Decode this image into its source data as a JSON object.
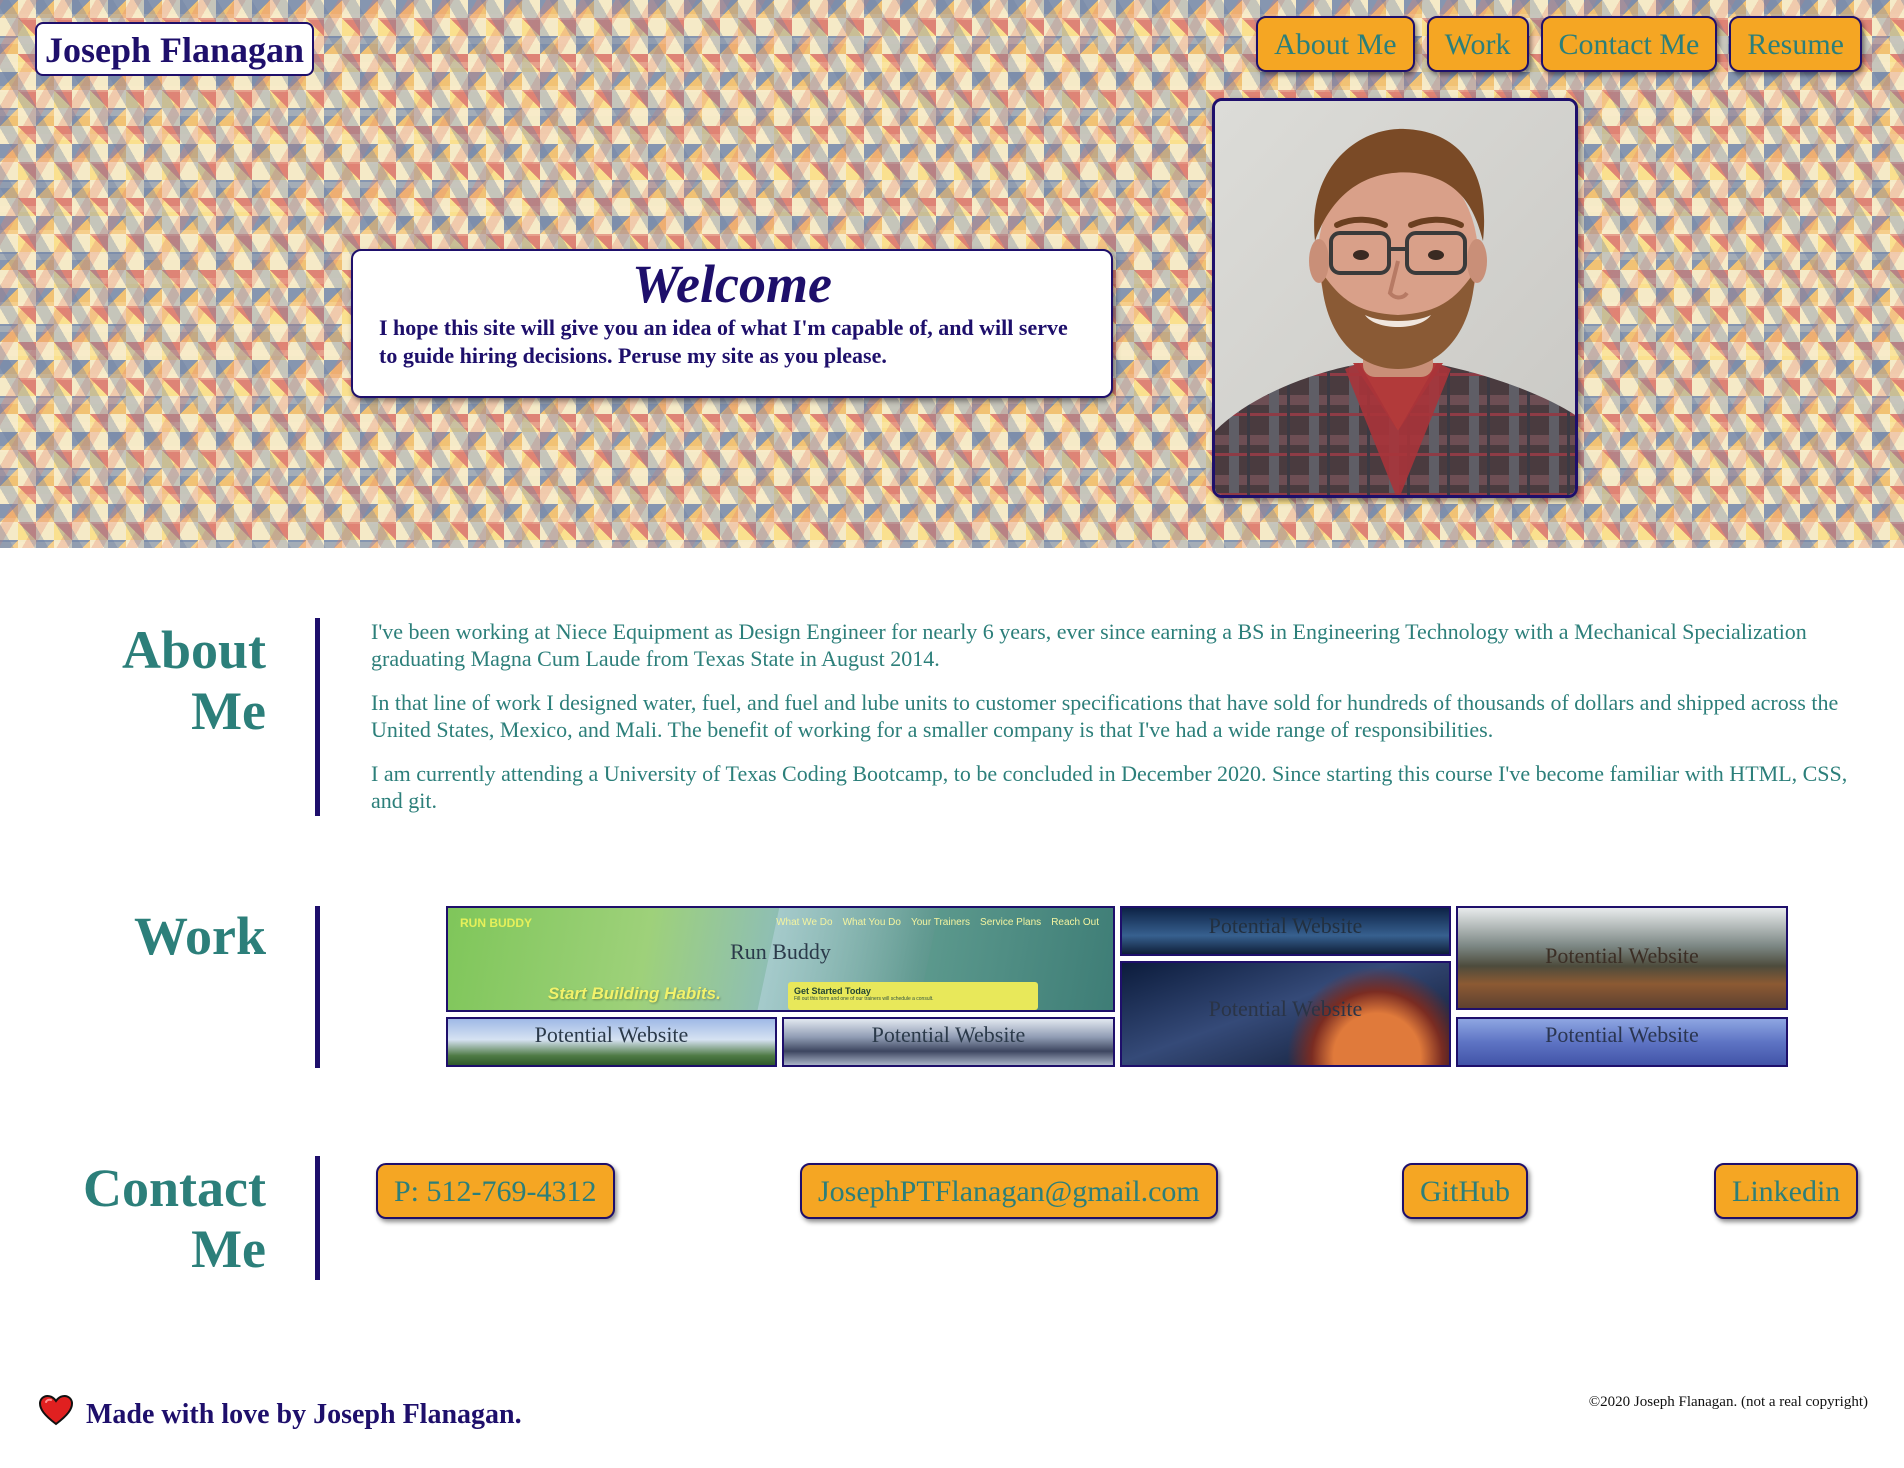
{
  "header": {
    "brand": "Joseph Flanagan",
    "nav": [
      "About Me",
      "Work",
      "Contact Me",
      "Resume"
    ]
  },
  "hero": {
    "welcome_title": "Welcome",
    "welcome_text": "I hope this site will give you an idea of what I'm capable of, and will serve to guide hiring decisions. Peruse my site as you please.",
    "portrait_alt": "portrait photo"
  },
  "about": {
    "title_line1": "About",
    "title_line2": "Me",
    "paragraphs": [
      "I've been working at Niece Equipment as Design Engineer for nearly 6 years, ever since earning a BS in Engineering Technology with a Mechanical Specialization graduating Magna Cum Laude from Texas State in August 2014.",
      "In that line of work I designed water, fuel, and fuel and lube units to customer specifications that have sold for hundreds of thousands of dollars and shipped across the United States, Mexico, and Mali. The benefit of working for a smaller company is that I've had a wide range of responsibilities.",
      "I am currently attending a University of Texas Coding Bootcamp, to be concluded in December 2020. Since starting this course I've become familiar with HTML, CSS, and git."
    ]
  },
  "work": {
    "title": "Work",
    "run_buddy": {
      "caption": "Run Buddy",
      "logo": "RUN BUDDY",
      "menu": [
        "What We Do",
        "What You Do",
        "Your Trainers",
        "Service Plans",
        "Reach Out"
      ],
      "tagline": "Start Building Habits.",
      "cta": "Get Started Today",
      "cta_sub": "Fill out this form and one of our trainers will schedule a consult."
    },
    "tiles": [
      "Potential Website",
      "Potential Website",
      "Potential Website",
      "Potential Website",
      "Potential Website",
      "Potential Website"
    ]
  },
  "contact": {
    "title_line1": "Contact",
    "title_line2": "Me",
    "phone": "P: 512-769-4312",
    "email": "JosephPTFlanagan@gmail.com",
    "github": "GitHub",
    "linkedin": "Linkedin"
  },
  "footer": {
    "made_with": "Made with love by Joseph Flanagan.",
    "copyright": "©2020 Joseph Flanagan. (not a real copyright)"
  },
  "colors": {
    "navy": "#1e0f6b",
    "teal": "#2c7f7a",
    "orange": "#f5a623",
    "heart": "#e02020"
  }
}
